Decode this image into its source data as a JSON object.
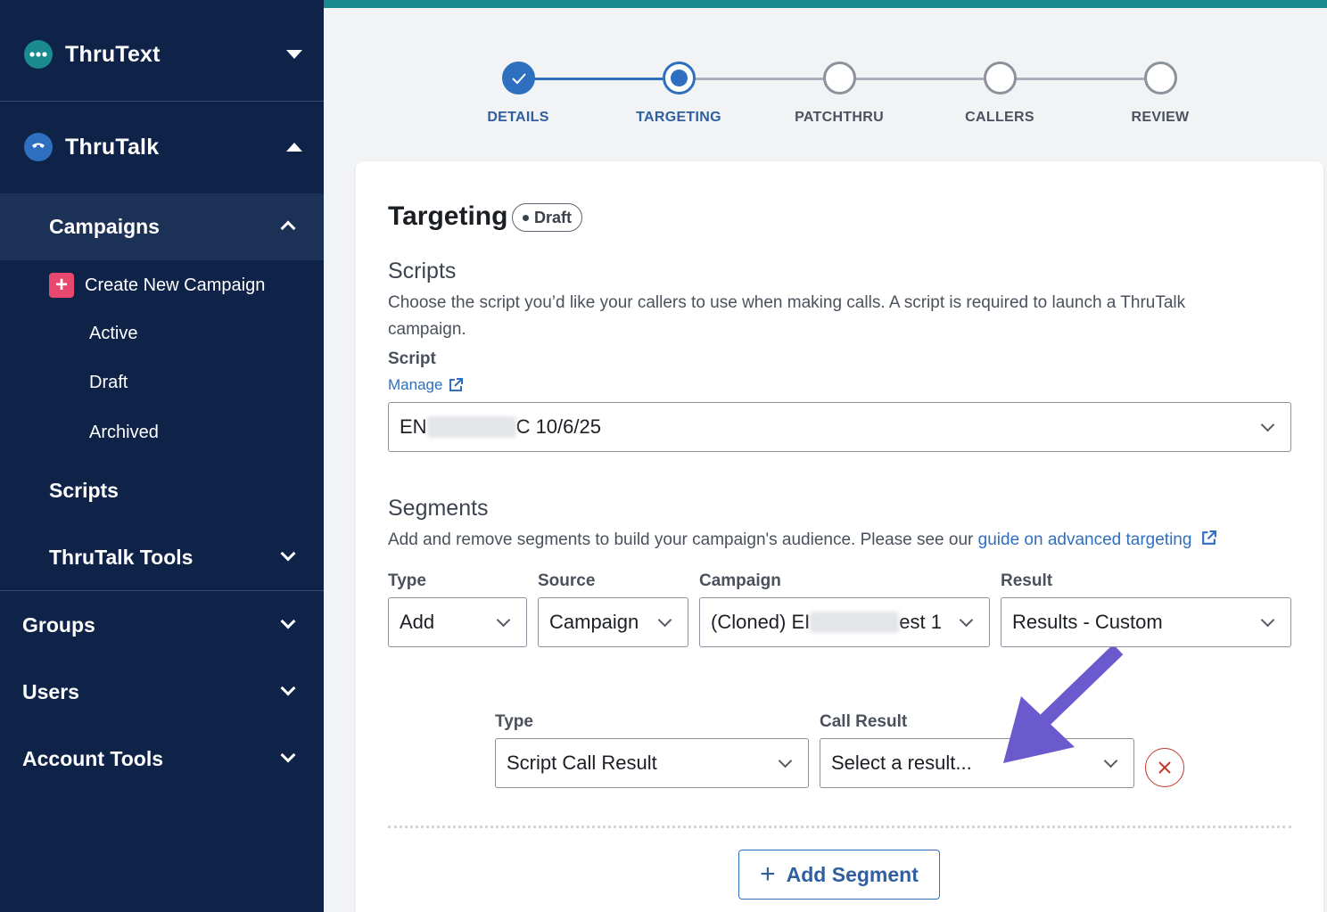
{
  "sidebar": {
    "apps": [
      {
        "name": "ThruText",
        "expanded": false
      },
      {
        "name": "ThruTalk",
        "expanded": true
      }
    ],
    "campaigns_label": "Campaigns",
    "create_label": "Create New Campaign",
    "campaign_items": [
      "Active",
      "Draft",
      "Archived"
    ],
    "scripts_label": "Scripts",
    "tools_label": "ThruTalk Tools",
    "groups_label": "Groups",
    "users_label": "Users",
    "account_tools_label": "Account Tools"
  },
  "stepper": {
    "steps": [
      "DETAILS",
      "TARGETING",
      "PATCHTHRU",
      "CALLERS",
      "REVIEW"
    ],
    "current": 1
  },
  "targeting": {
    "title": "Targeting",
    "status_badge": "Draft",
    "scripts_heading": "Scripts",
    "scripts_desc": "Choose the script you’d like your callers to use when making calls. A script is required to launch a ThruTalk campaign.",
    "script_label": "Script",
    "manage_link": "Manage",
    "script_value_prefix": "EN",
    "script_value_suffix": "C 10/6/25",
    "segments_heading": "Segments",
    "segments_desc": "Add and remove segments to build your campaign's audience. Please see our ",
    "segments_link": "guide on advanced targeting",
    "row1": {
      "type_label": "Type",
      "type_value": "Add",
      "source_label": "Source",
      "source_value": "Campaign",
      "campaign_label": "Campaign",
      "campaign_value_prefix": "(Cloned) EI",
      "campaign_value_suffix": "est 1",
      "result_label": "Result",
      "result_value": "Results - Custom"
    },
    "row2": {
      "type_label": "Type",
      "type_value": "Script Call Result",
      "call_result_label": "Call Result",
      "call_result_placeholder": "Select a result..."
    },
    "add_segment": "Add Segment"
  },
  "colors": {
    "sidebar_bg": "#0e2347",
    "accent": "#2f6fbf",
    "arrow": "#6a5acd",
    "danger": "#c0392b"
  }
}
